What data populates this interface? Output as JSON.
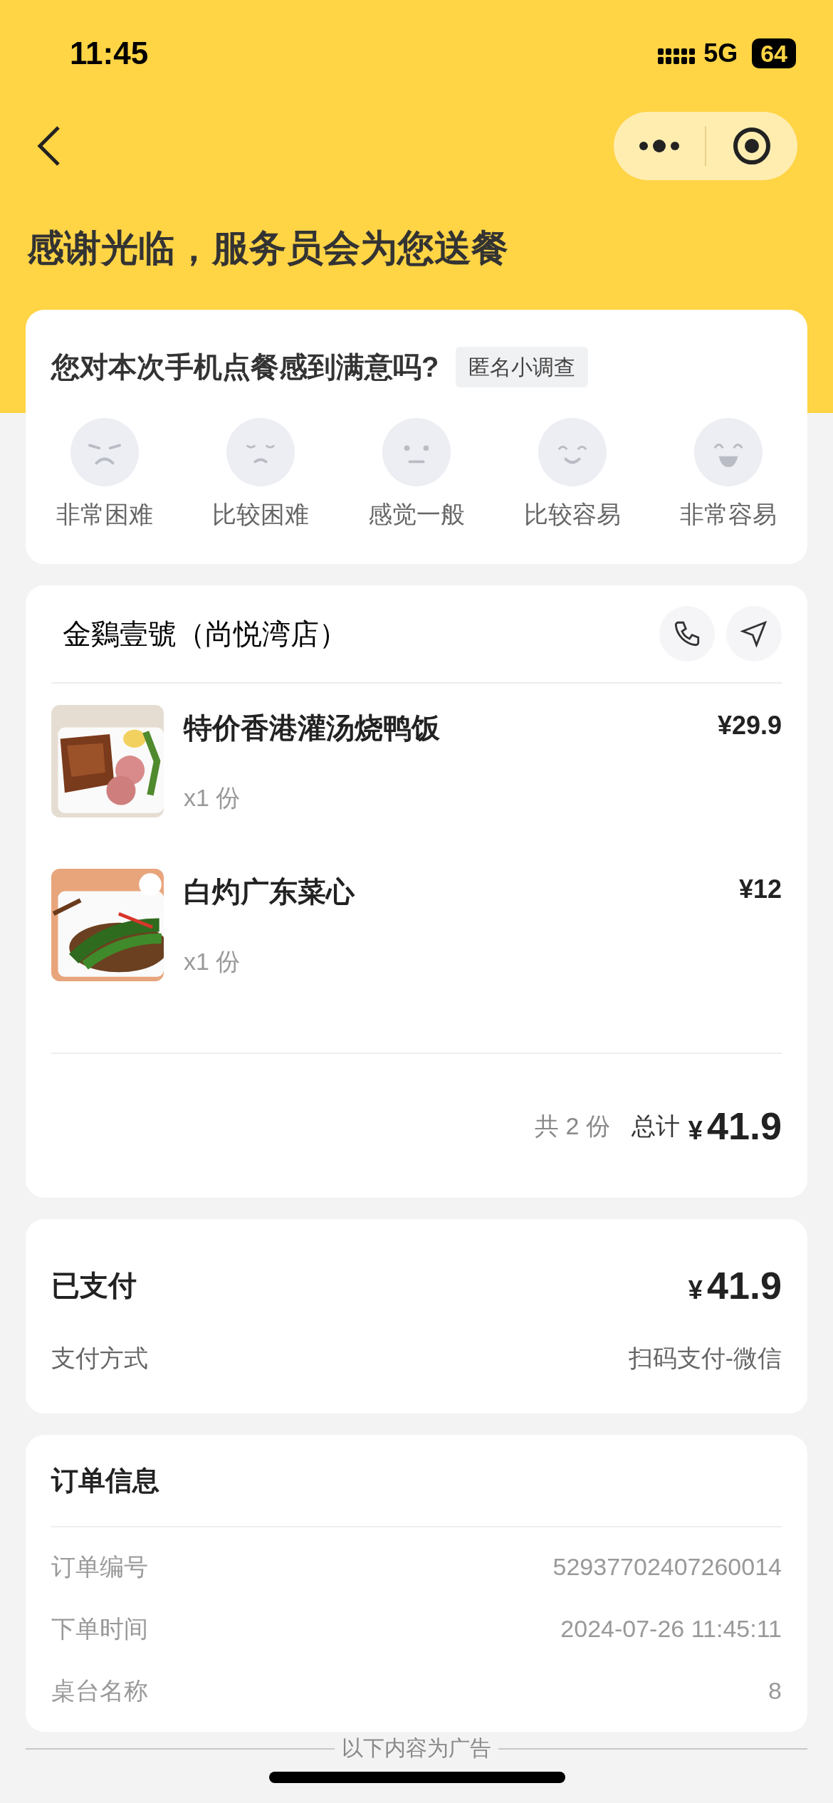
{
  "status_bar": {
    "time": "11:45",
    "network": "5G",
    "battery": "64"
  },
  "header": {
    "title": "感谢光临，服务员会为您送餐"
  },
  "survey": {
    "question": "您对本次手机点餐感到满意吗?",
    "tag": "匿名小调查",
    "options": [
      {
        "label": "非常困难"
      },
      {
        "label": "比较困难"
      },
      {
        "label": "感觉一般"
      },
      {
        "label": "比较容易"
      },
      {
        "label": "非常容易"
      }
    ]
  },
  "store": {
    "name": "金鷄壹號（尚悦湾店）",
    "items": [
      {
        "name": "特价香港灌汤烧鸭饭",
        "quantity": "x1 份",
        "price": "¥29.9"
      },
      {
        "name": "白灼广东菜心",
        "quantity": "x1 份",
        "price": "¥12"
      }
    ],
    "count": "共 2 份",
    "total_label": "总计",
    "currency": "¥",
    "total": "41.9"
  },
  "payment": {
    "status": "已支付",
    "currency": "¥",
    "amount": "41.9",
    "method_label": "支付方式",
    "method": "扫码支付-微信"
  },
  "order_info": {
    "title": "订单信息",
    "rows": [
      {
        "label": "订单编号",
        "value": "52937702407260014"
      },
      {
        "label": "下单时间",
        "value": "2024-07-26 11:45:11"
      },
      {
        "label": "桌台名称",
        "value": "8"
      }
    ]
  },
  "footer": {
    "ad_notice": "以下内容为广告"
  }
}
